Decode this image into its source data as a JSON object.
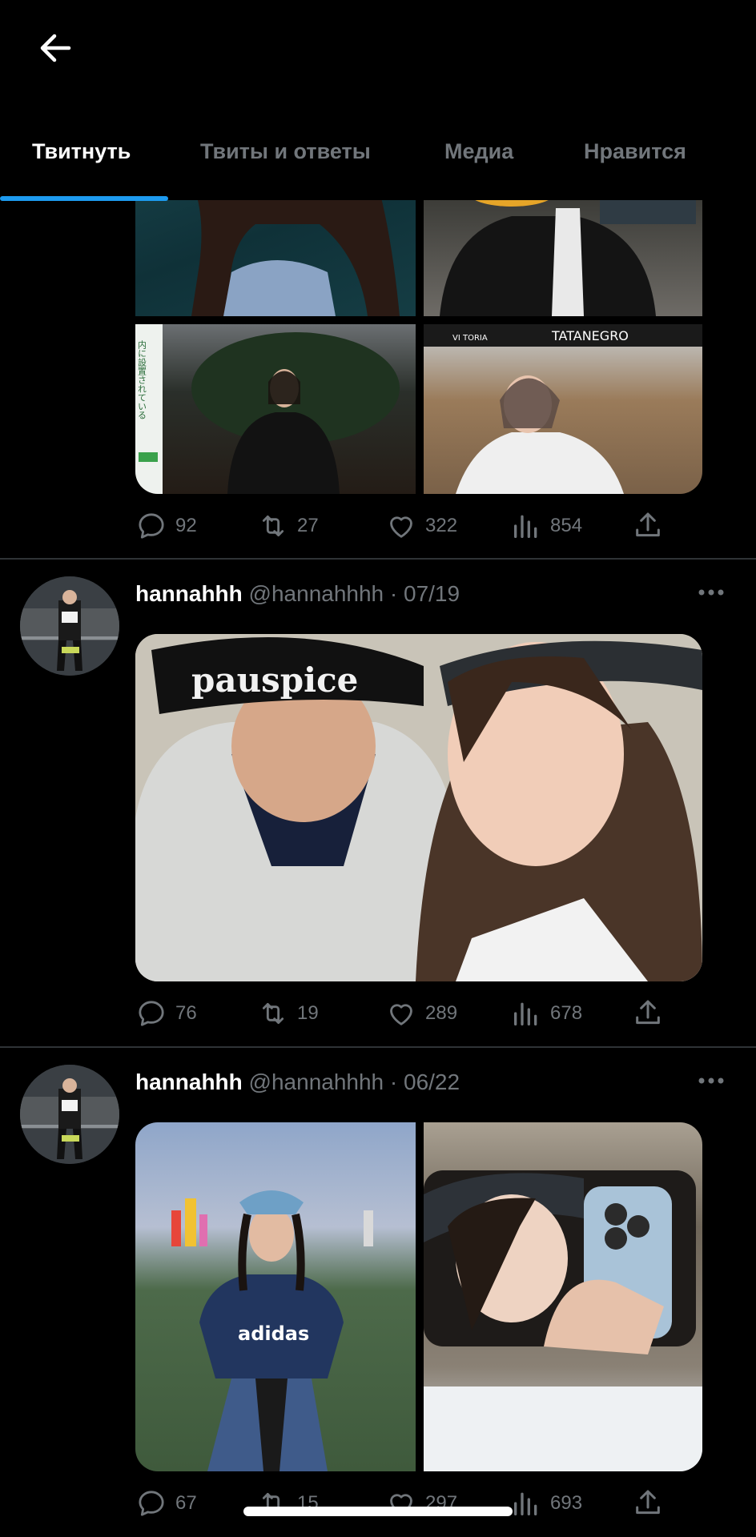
{
  "header": {
    "back_label": "Back",
    "tabs": [
      "Твитнуть",
      "Твиты и ответы",
      "Медиа",
      "Нравится"
    ],
    "active_tab": 0
  },
  "posts": [
    {
      "stats": {
        "replies": "92",
        "retweets": "27",
        "likes": "322",
        "views": "854"
      },
      "photo_text": {
        "sign": "TATANEGRO",
        "awning": "VI TORIA",
        "jp_sign": "内に設置されている"
      }
    },
    {
      "name": "hannahhh",
      "handle": "@hannahhhh · 07/19",
      "stats": {
        "replies": "76",
        "retweets": "19",
        "likes": "289",
        "views": "678"
      },
      "photo_text": {
        "beanie": "pauspice"
      }
    },
    {
      "name": "hannahhh",
      "handle": "@hannahhhh · 06/22",
      "stats": {
        "replies": "67",
        "retweets": "15",
        "likes": "297",
        "views": "693"
      },
      "photo_text": {
        "shirt": "adidas"
      }
    }
  ],
  "colors": {
    "background": "#000000",
    "accent": "#1d9bf0",
    "muted": "#71767b",
    "divider": "#2f3336"
  },
  "icons": [
    "back-arrow-icon",
    "reply-icon",
    "retweet-icon",
    "like-icon",
    "views-icon",
    "share-icon",
    "more-icon"
  ]
}
